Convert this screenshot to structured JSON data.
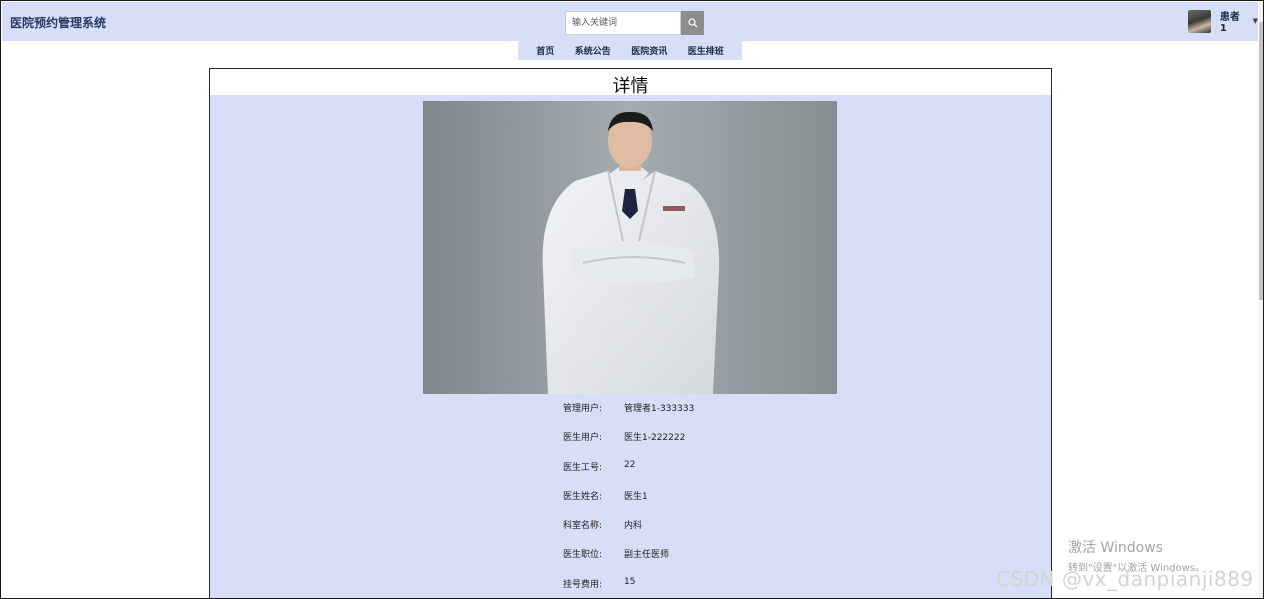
{
  "header": {
    "brand": "医院预约管理系统",
    "search_placeholder": "输入关键词",
    "user_name": "患者1",
    "caret": "▼"
  },
  "nav": {
    "items": [
      "首页",
      "系统公告",
      "医院资讯",
      "医生排班"
    ]
  },
  "detail": {
    "title": "详情",
    "fields": [
      {
        "label": "管理用户:",
        "value": "管理者1-333333"
      },
      {
        "label": "医生用户:",
        "value": "医生1-222222"
      },
      {
        "label": "医生工号:",
        "value": "22"
      },
      {
        "label": "医生姓名:",
        "value": "医生1"
      },
      {
        "label": "科室名称:",
        "value": "内科"
      },
      {
        "label": "医生职位:",
        "value": "副主任医师"
      },
      {
        "label": "挂号费用:",
        "value": "15"
      }
    ]
  },
  "overlay": {
    "activate_title": "激活 Windows",
    "activate_sub": "转到\"设置\"以激活 Windows。",
    "csdn": "CSDN @vx_danpianji889"
  },
  "colors": {
    "header_bg": "#d6def8",
    "panel_bg": "#d6def8",
    "brand_text": "#2b3a63"
  },
  "icons": [
    "search-icon",
    "avatar",
    "chevron-down-icon"
  ]
}
